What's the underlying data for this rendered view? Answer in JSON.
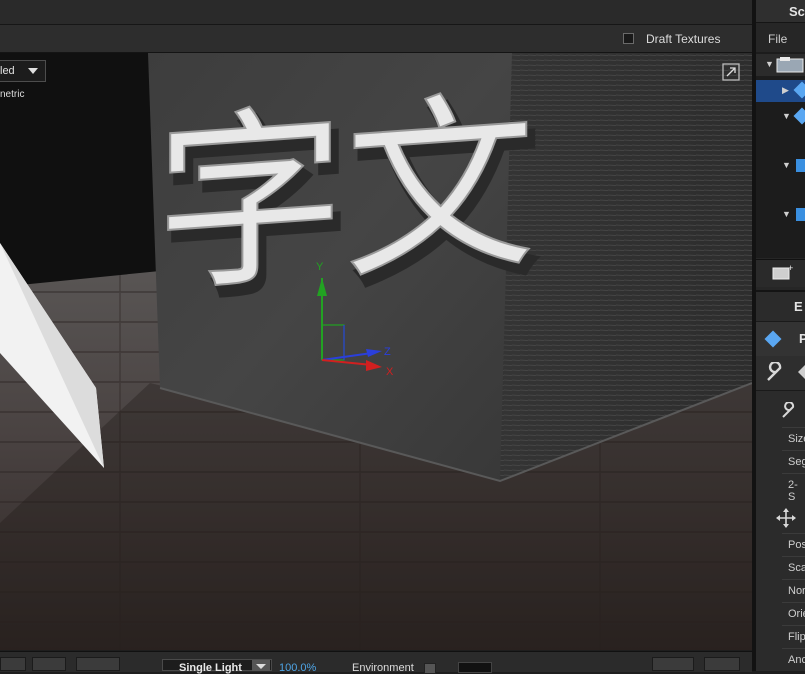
{
  "viewport": {
    "draft_textures_label": "Draft Textures",
    "shading_mode_visible": "led",
    "projection_visible": "netric",
    "sign_text": "字文",
    "axes": {
      "y": "Y",
      "z": "Z",
      "x": "X"
    }
  },
  "bottom_bar": {
    "light_mode": "Single Light",
    "intensity": "100.0%",
    "environment_label": "Environment"
  },
  "scene_panel": {
    "title_visible": "Sc",
    "file_menu": "File"
  },
  "edit_panel": {
    "title_visible": "E",
    "object_name_visible": "P",
    "property_labels": [
      "Size",
      "Seg",
      "2-S",
      "Pos",
      "Sca",
      "Nor",
      "Orie",
      "Flip",
      "Anc"
    ]
  },
  "colors": {
    "selection": "#1f4a8a",
    "accent_blue": "#4ea5e6",
    "axis_y": "#22a222",
    "axis_z": "#2a3fdc",
    "axis_x": "#d02020"
  }
}
